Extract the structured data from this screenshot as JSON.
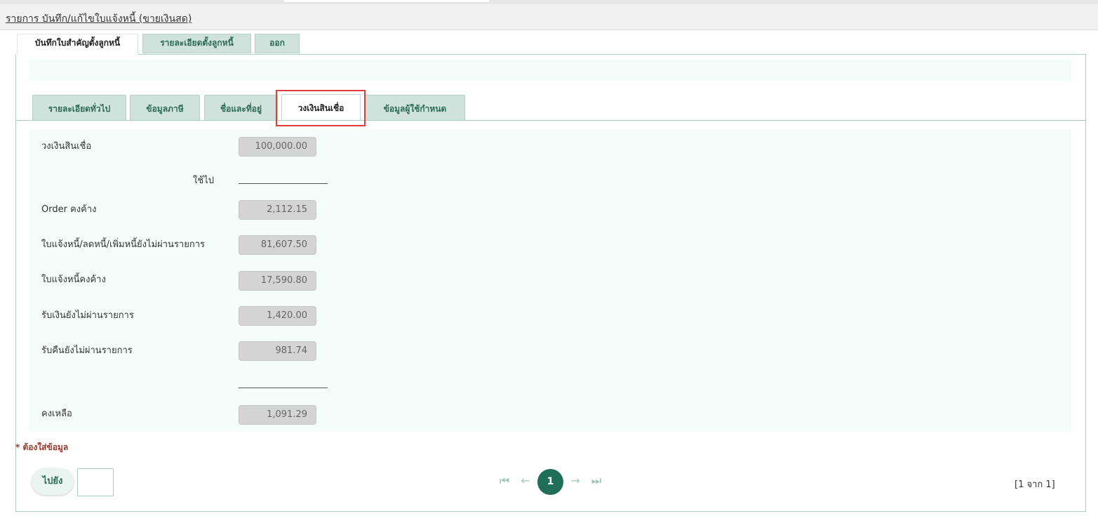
{
  "page_title": "รายการ บันทึก/แก้ไขใบแจ้งหนี้ (ขายเงินสด)",
  "main_tabs": [
    {
      "label": "บันทึกใบสำคัญตั้งลูกหนี้"
    },
    {
      "label": "รายละเอียดตั้งลูกหนี้"
    },
    {
      "label": "ออก"
    }
  ],
  "sub_tabs": [
    {
      "label": "รายละเอียดทั่วไป"
    },
    {
      "label": "ข้อมูลภาษี"
    },
    {
      "label": "ชื่อและที่อยู่"
    },
    {
      "label": "วงเงินสินเชื่อ"
    },
    {
      "label": "ข้อมูลผู้ใช้กำหนด"
    }
  ],
  "credit": {
    "credit_limit_label": "วงเงินสินเชื่อ",
    "credit_limit_value": "100,000.00",
    "used_label": "ใช้ไป",
    "order_label": "Order คงค้าง",
    "order_value": "2,112.15",
    "invoice_pending_label": "ใบแจ้งหนี้/ลดหนี้/เพิ่มหนี้ยังไม่ผ่านรายการ",
    "invoice_pending_value": "81,607.50",
    "invoice_outstanding_label": "ใบแจ้งหนี้คงค้าง",
    "invoice_outstanding_value": "17,590.80",
    "receipt_pending_label": "รับเงินยังไม่ผ่านรายการ",
    "receipt_pending_value": "1,420.00",
    "return_pending_label": "รับคืนยังไม่ผ่านรายการ",
    "return_pending_value": "981.74",
    "balance_label": "คงเหลือ",
    "balance_value": "1,091.29"
  },
  "required_note": "* ต้องใส่ข้อมูล",
  "pager": {
    "go_label": "ไปยัง",
    "current_page": "1",
    "info": "[1 จาก 1]"
  },
  "colors": {
    "accent": "#1f6e57",
    "tab_bg": "#cfe3dc",
    "panel_bg": "#f4fdf9",
    "highlight": "#e23b3b"
  }
}
